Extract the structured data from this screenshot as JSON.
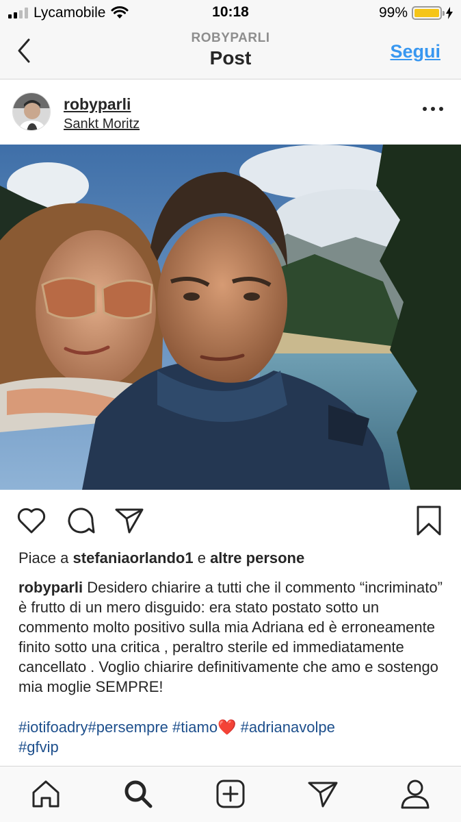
{
  "status_bar": {
    "carrier": "Lycamobile",
    "time": "10:18",
    "battery": "99%",
    "battery_level": 0.99
  },
  "header": {
    "subtitle": "ROBYPARLI",
    "title": "Post",
    "follow_label": "Segui"
  },
  "post": {
    "username": "robyparli",
    "location": "Sankt Moritz",
    "likes": {
      "prefix": "Piace a",
      "user": "stefaniaorlando1",
      "connector": "e",
      "others": "altre persone"
    },
    "caption": {
      "username": "robyparli",
      "text": "Desidero chiarire a tutti che il commento “incriminato” è frutto di un mero disguido: era stato postato sotto un commento molto positivo sulla mia Adriana ed è erroneamente finito sotto una critica , peraltro sterile ed immediatamente cancellato . Voglio chiarire definitivamente che amo e sostengo mia moglie SEMPRE!"
    },
    "hashtags": {
      "tag1": "#iotifoadry#persempre",
      "tag2": "#tiamo",
      "emoji": "❤️",
      "tag3": "#adrianavolpe",
      "tag4": "#gfvip"
    }
  },
  "icons": {
    "back": "chevron-left-icon",
    "more": "more-horizontal-icon",
    "like": "heart-icon",
    "comment": "comment-icon",
    "share": "send-icon",
    "save": "bookmark-icon",
    "home": "home-icon",
    "search": "search-icon",
    "new_post": "plus-square-icon",
    "direct": "send-icon",
    "profile": "profile-icon"
  },
  "colors": {
    "accent": "#3897f0",
    "hashtag": "#1d4f8c",
    "battery": "#f5c518",
    "text": "#262626"
  }
}
